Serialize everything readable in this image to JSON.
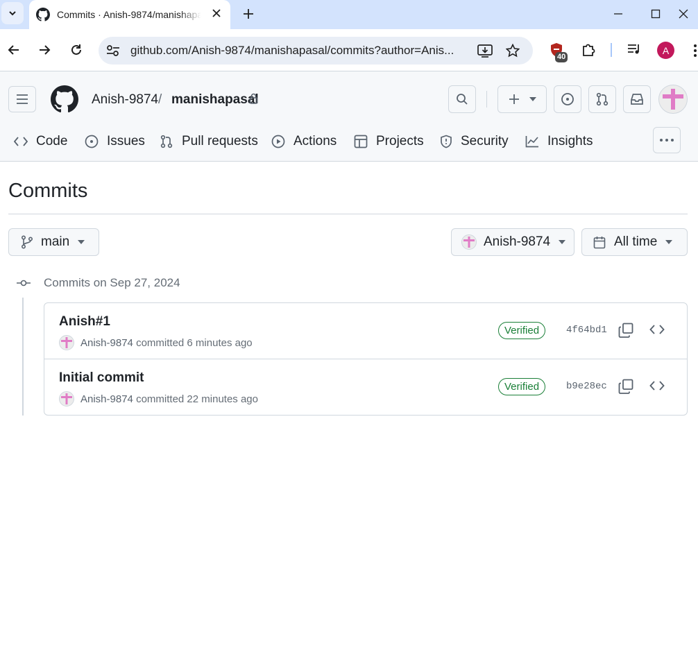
{
  "browser": {
    "tab_title": "Commits · Anish-9874/manishapasal",
    "url": "github.com/Anish-9874/manishapasal/commits?author=Anis...",
    "extension_badge": "40",
    "profile_initial": "A"
  },
  "header": {
    "owner": "Anish-9874",
    "separator": "/",
    "repo": "manishapasal"
  },
  "repo_nav": {
    "code": "Code",
    "issues": "Issues",
    "pull_requests": "Pull requests",
    "actions": "Actions",
    "projects": "Projects",
    "security": "Security",
    "insights": "Insights"
  },
  "page": {
    "title": "Commits",
    "branch": "main",
    "author_filter": "Anish-9874",
    "time_filter": "All time",
    "day_label": "Commits on Sep 27, 2024"
  },
  "commits": [
    {
      "message": "Anish#1",
      "author": "Anish-9874",
      "action": "committed",
      "time": "6 minutes ago",
      "verified": "Verified",
      "sha": "4f64bd1"
    },
    {
      "message": "Initial commit",
      "author": "Anish-9874",
      "action": "committed",
      "time": "22 minutes ago",
      "verified": "Verified",
      "sha": "b9e28ec"
    }
  ],
  "colors": {
    "accent_green": "#1a7f37",
    "identicon_pink": "#e07cc6",
    "tabstrip": "#d3e3fd"
  }
}
